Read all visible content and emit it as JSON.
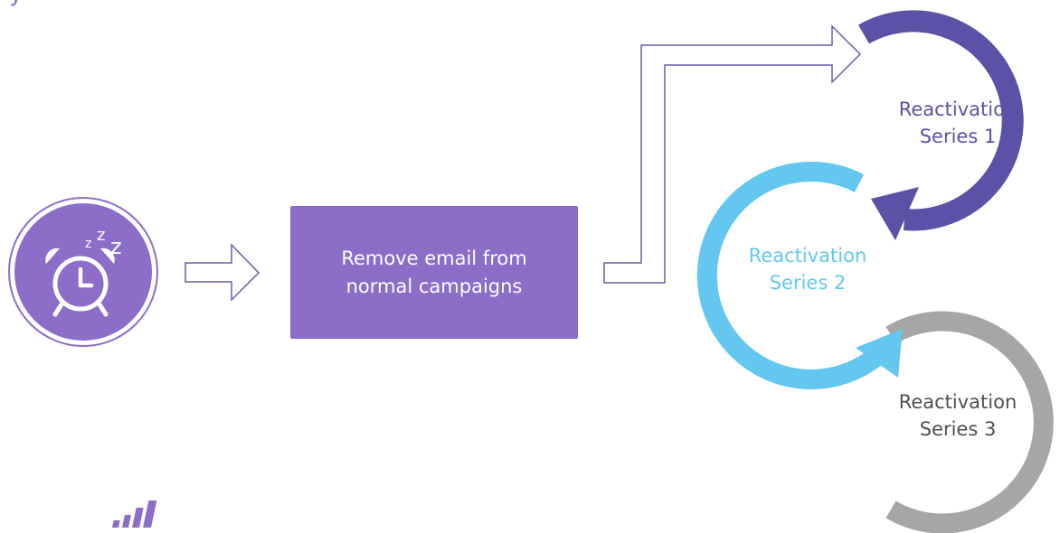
{
  "colors": {
    "purple": "#8c6dc8",
    "deep_purple": "#5a52a6",
    "arrow_outline": "#6f5aa8",
    "light_blue": "#63c7f0",
    "gray": "#a6a6a6",
    "white": "#ffffff",
    "series_3_text": "#505050"
  },
  "header": {
    "caption": "y"
  },
  "icons": {
    "alarm": "sleeping-alarm-clock-icon",
    "brand": "bars-logo-icon"
  },
  "flow": {
    "step": {
      "line1": "Remove email from",
      "line2": "normal campaigns"
    },
    "series": [
      {
        "line1": "Reactivation",
        "line2": "Series 1"
      },
      {
        "line1": "Reactivation",
        "line2": "Series 2"
      },
      {
        "line1": "Reactivation",
        "line2": "Series 3"
      }
    ]
  }
}
